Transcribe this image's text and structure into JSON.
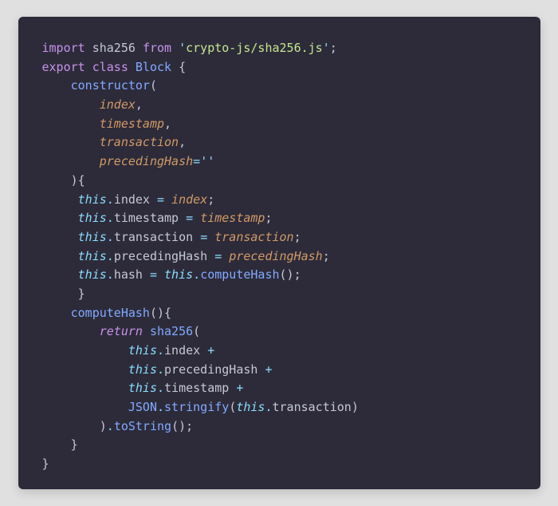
{
  "code": {
    "line1": {
      "import": "import",
      "sha256": "sha256",
      "from": "from",
      "quote1": "'",
      "str": "crypto-js/sha256.js",
      "quote2": "'",
      "semi": ";"
    },
    "line2": {
      "export": "export",
      "class": "class",
      "name": "Block",
      "brace": " {"
    },
    "line3": {
      "indent": "    ",
      "constructor": "constructor",
      "paren": "("
    },
    "line4": {
      "indent": "        ",
      "param": "index",
      "comma": ","
    },
    "line5": {
      "indent": "        ",
      "param": "timestamp",
      "comma": ","
    },
    "line6": {
      "indent": "        ",
      "param": "transaction",
      "comma": ","
    },
    "line7": {
      "indent": "        ",
      "param": "precedingHash",
      "eq": "=",
      "q1": "'",
      "q2": "'"
    },
    "line8": {
      "indent": "    ",
      "close": "){"
    },
    "line9": {
      "indent": "     ",
      "this": "this",
      "dot": ".",
      "prop": "index",
      "sp": " ",
      "op": "=",
      "sp2": " ",
      "val": "index",
      "semi": ";"
    },
    "line10": {
      "indent": "     ",
      "this": "this",
      "dot": ".",
      "prop": "timestamp",
      "sp": " ",
      "op": "=",
      "sp2": " ",
      "val": "timestamp",
      "semi": ";"
    },
    "line11": {
      "indent": "     ",
      "this": "this",
      "dot": ".",
      "prop": "transaction",
      "sp": " ",
      "op": "=",
      "sp2": " ",
      "val": "transaction",
      "semi": ";"
    },
    "line12": {
      "indent": "     ",
      "this": "this",
      "dot": ".",
      "prop": "precedingHash",
      "sp": " ",
      "op": "=",
      "sp2": " ",
      "val": "precedingHash",
      "semi": ";"
    },
    "line13": {
      "indent": "     ",
      "this": "this",
      "dot": ".",
      "prop": "hash",
      "sp": " ",
      "op": "=",
      "sp2": " ",
      "this2": "this",
      "dot2": ".",
      "call": "computeHash",
      "parens": "()",
      "semi": ";"
    },
    "line14": {
      "indent": "     ",
      "brace": "}"
    },
    "line15": {
      "indent": "    ",
      "method": "computeHash",
      "parens": "(){"
    },
    "line16": {
      "indent": "        ",
      "return": "return",
      "sp": " ",
      "sha256": "sha256",
      "paren": "("
    },
    "line17": {
      "indent": "            ",
      "this": "this",
      "dot": ".",
      "prop": "index",
      "sp": " ",
      "plus": "+"
    },
    "line18": {
      "indent": "            ",
      "this": "this",
      "dot": ".",
      "prop": "precedingHash",
      "sp": " ",
      "plus": "+"
    },
    "line19": {
      "indent": "            ",
      "this": "this",
      "dot": ".",
      "prop": "timestamp",
      "sp": " ",
      "plus": "+"
    },
    "line20": {
      "indent": "            ",
      "json": "JSON",
      "dot": ".",
      "stringify": "stringify",
      "p1": "(",
      "this": "this",
      "dot2": ".",
      "prop": "transaction",
      "p2": ")"
    },
    "line21": {
      "indent": "        ",
      "close": ")",
      "dot": ".",
      "tostring": "toString",
      "parens": "()",
      "semi": ";"
    },
    "line22": {
      "indent": "    ",
      "brace": "}"
    },
    "line23": {
      "brace": "}"
    }
  }
}
